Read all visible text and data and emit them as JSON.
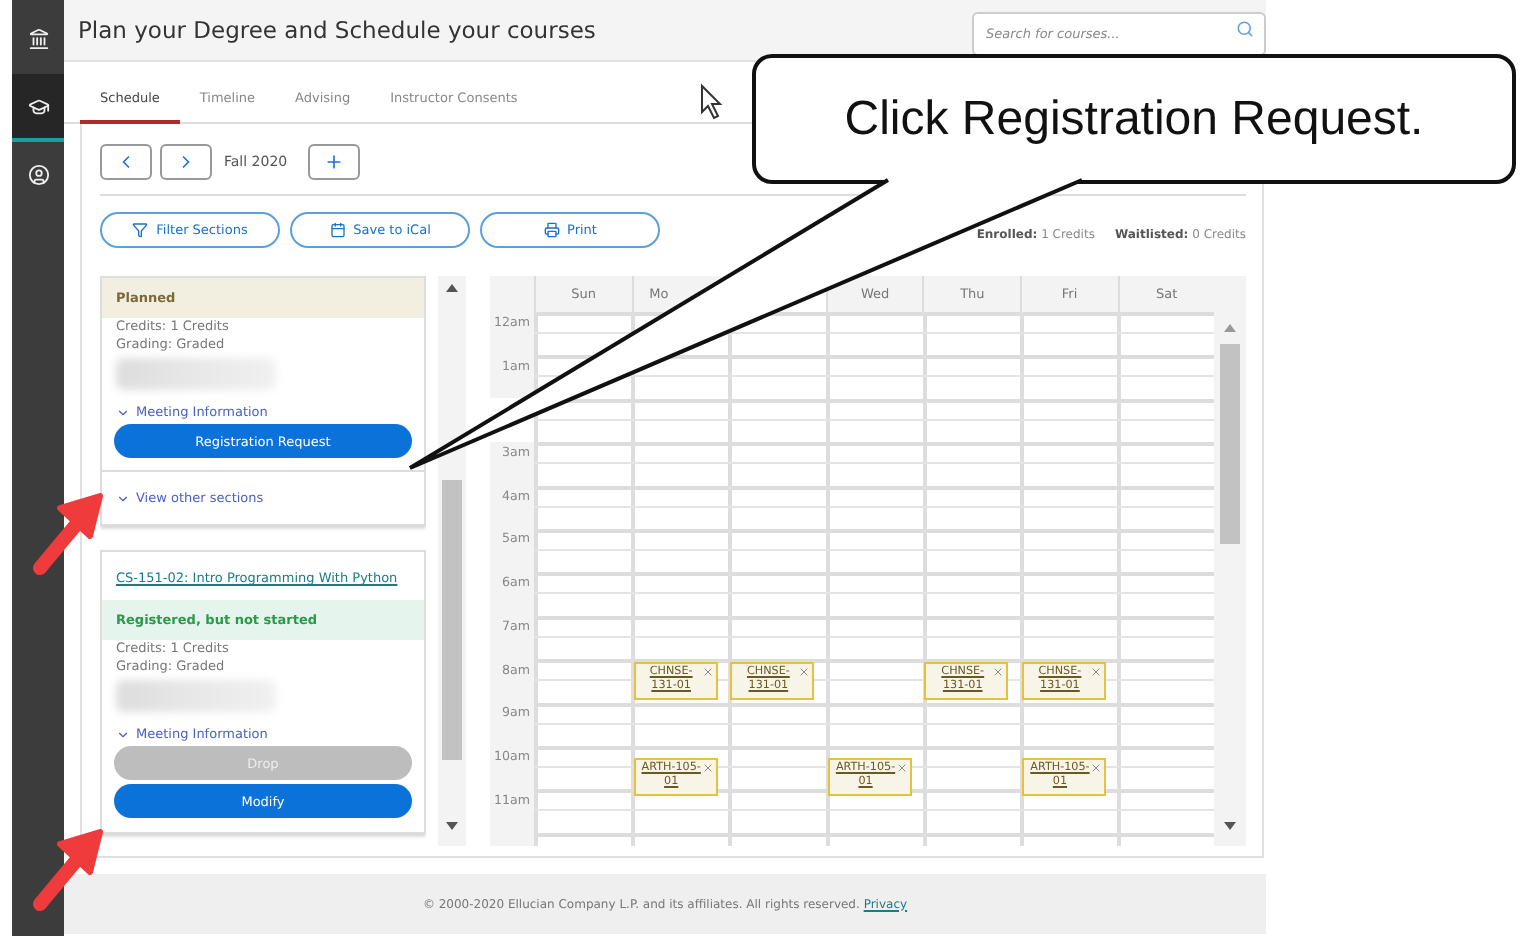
{
  "sidebar": {
    "items": [
      {
        "kind": "institution",
        "selected": false
      },
      {
        "kind": "graduation",
        "selected": true
      },
      {
        "kind": "profile",
        "selected": false
      }
    ]
  },
  "header": {
    "title": "Plan your Degree and Schedule your courses",
    "search": {
      "placeholder": "Search for courses..."
    }
  },
  "tabs": [
    {
      "label": "Schedule",
      "selected": true
    },
    {
      "label": "Timeline",
      "selected": false
    },
    {
      "label": "Advising",
      "selected": false
    },
    {
      "label": "Instructor Consents",
      "selected": false
    }
  ],
  "term": {
    "label": "Fall 2020"
  },
  "toolbar": {
    "buttons": [
      {
        "kind": "filter",
        "label": "Filter Sections"
      },
      {
        "kind": "calendar",
        "label": "Save to iCal"
      },
      {
        "kind": "print",
        "label": "Print"
      }
    ]
  },
  "credits": [
    {
      "label": "Enrolled:",
      "value": "1 Credits"
    },
    {
      "label": "Waitlisted:",
      "value": "0 Credits"
    }
  ],
  "courses": [
    {
      "status": "Planned",
      "kind": "planned",
      "details": [
        "Credits: 1 Credits",
        "Grading: Graded"
      ],
      "meeting_link": "Meeting Information",
      "actions": [
        {
          "label": "Registration Request",
          "disabled": false
        }
      ],
      "other_sections": "View other sections"
    },
    {
      "title": "CS-151-02: Intro Programming With Python",
      "status": "Registered, but not started",
      "kind": "registered",
      "details": [
        "Credits: 1 Credits",
        "Grading: Graded"
      ],
      "meeting_link": "Meeting Information",
      "actions": [
        {
          "label": "Drop",
          "disabled": true
        },
        {
          "label": "Modify",
          "disabled": false
        }
      ]
    }
  ],
  "calendar": {
    "days": [
      {
        "label": "Sun"
      },
      {
        "label": "Mo"
      },
      {
        "covered": true
      },
      {
        "label": "Wed"
      },
      {
        "label": "Thu"
      },
      {
        "label": "Fri"
      },
      {
        "label": "Sat"
      }
    ],
    "hours": [
      {
        "label": "12am"
      },
      {
        "label": "1am"
      },
      {
        "covered": true
      },
      {
        "label": "3am"
      },
      {
        "label": "4am"
      },
      {
        "label": "5am"
      },
      {
        "label": "6am"
      },
      {
        "label": "7am"
      },
      {
        "label": "8am",
        "cells": [
          {},
          {
            "event": "CHNSE-131-01"
          },
          {
            "event": "CHNSE-131-01"
          },
          {},
          {
            "event": "CHNSE-131-01"
          },
          {
            "event": "CHNSE-131-01"
          },
          {}
        ]
      },
      {
        "label": "9am"
      },
      {
        "label": "10am",
        "cells": [
          {},
          {
            "event": "ARTH-105-01"
          },
          {},
          {
            "event": "ARTH-105-01"
          },
          {},
          {
            "event": "ARTH-105-01"
          },
          {}
        ]
      },
      {
        "label": "11am"
      }
    ]
  },
  "footer": {
    "text": "© 2000-2020 Ellucian Company L.P. and its affiliates. All rights reserved.",
    "link": "Privacy"
  },
  "callout": {
    "text": "Click Registration Request."
  }
}
